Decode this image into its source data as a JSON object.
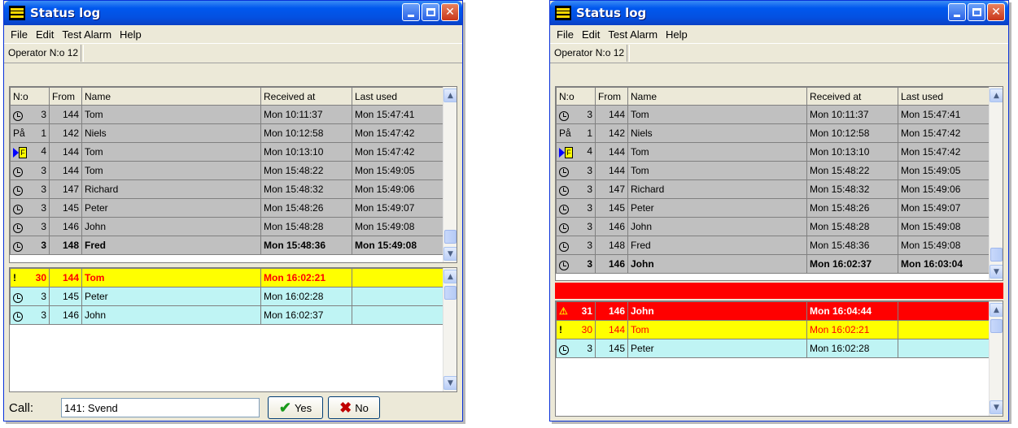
{
  "windows": [
    {
      "title": "Status log",
      "menu": [
        "File",
        "Edit",
        "Test Alarm",
        "Help"
      ],
      "operator": "Operator N:o 12",
      "columns": [
        "N:o",
        "From",
        "Name",
        "Received at",
        "Last used"
      ],
      "upper_rows": [
        {
          "icon": "clock-icon",
          "no": "3",
          "from": "144",
          "name": "Tom",
          "received": "Mon 10:11:37",
          "last": "Mon 15:47:41"
        },
        {
          "icon": "pa-text",
          "icon_text": "På",
          "no": "1",
          "from": "142",
          "name": "Niels",
          "received": "Mon 10:12:58",
          "last": "Mon 15:47:42"
        },
        {
          "icon": "flag-icon",
          "icon_text": "F",
          "no": "4",
          "from": "144",
          "name": "Tom",
          "received": "Mon 10:13:10",
          "last": "Mon 15:47:42"
        },
        {
          "icon": "clock-icon",
          "no": "3",
          "from": "144",
          "name": "Tom",
          "received": "Mon 15:48:22",
          "last": "Mon 15:49:05"
        },
        {
          "icon": "clock-icon",
          "no": "3",
          "from": "147",
          "name": "Richard",
          "received": "Mon 15:48:32",
          "last": "Mon 15:49:06"
        },
        {
          "icon": "clock-icon",
          "no": "3",
          "from": "145",
          "name": "Peter",
          "received": "Mon 15:48:26",
          "last": "Mon 15:49:07"
        },
        {
          "icon": "clock-icon",
          "no": "3",
          "from": "146",
          "name": "John",
          "received": "Mon 15:48:28",
          "last": "Mon 15:49:08"
        },
        {
          "icon": "clock-icon",
          "no": "3",
          "from": "148",
          "name": "Fred",
          "received": "Mon 15:48:36",
          "last": "Mon 15:49:08",
          "bold": true
        }
      ],
      "lower_rows": [
        {
          "icon": "exclamation-icon",
          "icon_text": "!",
          "no": "30",
          "from": "144",
          "name": "Tom",
          "received": "Mon 16:02:21",
          "last": "",
          "style": "yellow"
        },
        {
          "icon": "clock-icon",
          "no": "3",
          "from": "145",
          "name": "Peter",
          "received": "Mon 16:02:28",
          "last": "",
          "style": "cyan"
        },
        {
          "icon": "clock-icon",
          "no": "3",
          "from": "146",
          "name": "John",
          "received": "Mon 16:02:37",
          "last": "",
          "style": "cyan"
        }
      ],
      "call": {
        "label": "Call:",
        "value": "141: Svend",
        "yes": "Yes",
        "no": "No"
      }
    },
    {
      "title": "Status log",
      "menu": [
        "File",
        "Edit",
        "Test Alarm",
        "Help"
      ],
      "operator": "Operator N:o 12",
      "columns": [
        "N:o",
        "From",
        "Name",
        "Received at",
        "Last used"
      ],
      "upper_rows": [
        {
          "icon": "clock-icon",
          "no": "3",
          "from": "144",
          "name": "Tom",
          "received": "Mon 10:11:37",
          "last": "Mon 15:47:41"
        },
        {
          "icon": "pa-text",
          "icon_text": "På",
          "no": "1",
          "from": "142",
          "name": "Niels",
          "received": "Mon 10:12:58",
          "last": "Mon 15:47:42"
        },
        {
          "icon": "flag-icon",
          "icon_text": "F",
          "no": "4",
          "from": "144",
          "name": "Tom",
          "received": "Mon 10:13:10",
          "last": "Mon 15:47:42"
        },
        {
          "icon": "clock-icon",
          "no": "3",
          "from": "144",
          "name": "Tom",
          "received": "Mon 15:48:22",
          "last": "Mon 15:49:05"
        },
        {
          "icon": "clock-icon",
          "no": "3",
          "from": "147",
          "name": "Richard",
          "received": "Mon 15:48:32",
          "last": "Mon 15:49:06"
        },
        {
          "icon": "clock-icon",
          "no": "3",
          "from": "145",
          "name": "Peter",
          "received": "Mon 15:48:26",
          "last": "Mon 15:49:07"
        },
        {
          "icon": "clock-icon",
          "no": "3",
          "from": "146",
          "name": "John",
          "received": "Mon 15:48:28",
          "last": "Mon 15:49:08"
        },
        {
          "icon": "clock-icon",
          "no": "3",
          "from": "148",
          "name": "Fred",
          "received": "Mon 15:48:36",
          "last": "Mon 15:49:08"
        },
        {
          "icon": "clock-icon",
          "no": "3",
          "from": "146",
          "name": "John",
          "received": "Mon 16:02:37",
          "last": "Mon 16:03:04",
          "bold": true
        }
      ],
      "lower_rows": [
        {
          "icon": "warning-icon",
          "icon_text": "⚠",
          "no": "31",
          "from": "146",
          "name": "John",
          "received": "Mon 16:04:44",
          "last": "",
          "style": "red"
        },
        {
          "icon": "exclamation-icon",
          "icon_text": "!",
          "no": "30",
          "from": "144",
          "name": "Tom",
          "received": "Mon 16:02:21",
          "last": "",
          "style": "yellow2"
        },
        {
          "icon": "clock-icon",
          "no": "3",
          "from": "145",
          "name": "Peter",
          "received": "Mon 16:02:28",
          "last": "",
          "style": "cyan"
        }
      ]
    }
  ],
  "colors": {
    "alarm_red": "#ff0000",
    "alarm_yellow": "#ffff00",
    "cyan_row": "#bff4f4",
    "gray_row": "#c0c0c0",
    "title_blue": "#0058ee"
  }
}
